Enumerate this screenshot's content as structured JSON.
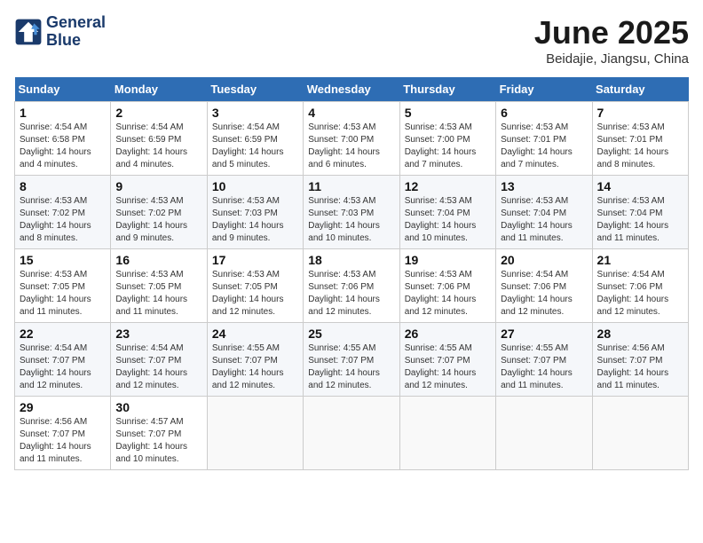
{
  "header": {
    "logo": {
      "line1": "General",
      "line2": "Blue"
    },
    "title": "June 2025",
    "location": "Beidajie, Jiangsu, China"
  },
  "weekdays": [
    "Sunday",
    "Monday",
    "Tuesday",
    "Wednesday",
    "Thursday",
    "Friday",
    "Saturday"
  ],
  "weeks": [
    [
      {
        "day": 1,
        "sunrise": "4:54 AM",
        "sunset": "6:58 PM",
        "daylight": "14 hours and 4 minutes."
      },
      {
        "day": 2,
        "sunrise": "4:54 AM",
        "sunset": "6:59 PM",
        "daylight": "14 hours and 4 minutes."
      },
      {
        "day": 3,
        "sunrise": "4:54 AM",
        "sunset": "6:59 PM",
        "daylight": "14 hours and 5 minutes."
      },
      {
        "day": 4,
        "sunrise": "4:53 AM",
        "sunset": "7:00 PM",
        "daylight": "14 hours and 6 minutes."
      },
      {
        "day": 5,
        "sunrise": "4:53 AM",
        "sunset": "7:00 PM",
        "daylight": "14 hours and 7 minutes."
      },
      {
        "day": 6,
        "sunrise": "4:53 AM",
        "sunset": "7:01 PM",
        "daylight": "14 hours and 7 minutes."
      },
      {
        "day": 7,
        "sunrise": "4:53 AM",
        "sunset": "7:01 PM",
        "daylight": "14 hours and 8 minutes."
      }
    ],
    [
      {
        "day": 8,
        "sunrise": "4:53 AM",
        "sunset": "7:02 PM",
        "daylight": "14 hours and 8 minutes."
      },
      {
        "day": 9,
        "sunrise": "4:53 AM",
        "sunset": "7:02 PM",
        "daylight": "14 hours and 9 minutes."
      },
      {
        "day": 10,
        "sunrise": "4:53 AM",
        "sunset": "7:03 PM",
        "daylight": "14 hours and 9 minutes."
      },
      {
        "day": 11,
        "sunrise": "4:53 AM",
        "sunset": "7:03 PM",
        "daylight": "14 hours and 10 minutes."
      },
      {
        "day": 12,
        "sunrise": "4:53 AM",
        "sunset": "7:04 PM",
        "daylight": "14 hours and 10 minutes."
      },
      {
        "day": 13,
        "sunrise": "4:53 AM",
        "sunset": "7:04 PM",
        "daylight": "14 hours and 11 minutes."
      },
      {
        "day": 14,
        "sunrise": "4:53 AM",
        "sunset": "7:04 PM",
        "daylight": "14 hours and 11 minutes."
      }
    ],
    [
      {
        "day": 15,
        "sunrise": "4:53 AM",
        "sunset": "7:05 PM",
        "daylight": "14 hours and 11 minutes."
      },
      {
        "day": 16,
        "sunrise": "4:53 AM",
        "sunset": "7:05 PM",
        "daylight": "14 hours and 11 minutes."
      },
      {
        "day": 17,
        "sunrise": "4:53 AM",
        "sunset": "7:05 PM",
        "daylight": "14 hours and 12 minutes."
      },
      {
        "day": 18,
        "sunrise": "4:53 AM",
        "sunset": "7:06 PM",
        "daylight": "14 hours and 12 minutes."
      },
      {
        "day": 19,
        "sunrise": "4:53 AM",
        "sunset": "7:06 PM",
        "daylight": "14 hours and 12 minutes."
      },
      {
        "day": 20,
        "sunrise": "4:54 AM",
        "sunset": "7:06 PM",
        "daylight": "14 hours and 12 minutes."
      },
      {
        "day": 21,
        "sunrise": "4:54 AM",
        "sunset": "7:06 PM",
        "daylight": "14 hours and 12 minutes."
      }
    ],
    [
      {
        "day": 22,
        "sunrise": "4:54 AM",
        "sunset": "7:07 PM",
        "daylight": "14 hours and 12 minutes."
      },
      {
        "day": 23,
        "sunrise": "4:54 AM",
        "sunset": "7:07 PM",
        "daylight": "14 hours and 12 minutes."
      },
      {
        "day": 24,
        "sunrise": "4:55 AM",
        "sunset": "7:07 PM",
        "daylight": "14 hours and 12 minutes."
      },
      {
        "day": 25,
        "sunrise": "4:55 AM",
        "sunset": "7:07 PM",
        "daylight": "14 hours and 12 minutes."
      },
      {
        "day": 26,
        "sunrise": "4:55 AM",
        "sunset": "7:07 PM",
        "daylight": "14 hours and 12 minutes."
      },
      {
        "day": 27,
        "sunrise": "4:55 AM",
        "sunset": "7:07 PM",
        "daylight": "14 hours and 11 minutes."
      },
      {
        "day": 28,
        "sunrise": "4:56 AM",
        "sunset": "7:07 PM",
        "daylight": "14 hours and 11 minutes."
      }
    ],
    [
      {
        "day": 29,
        "sunrise": "4:56 AM",
        "sunset": "7:07 PM",
        "daylight": "14 hours and 11 minutes."
      },
      {
        "day": 30,
        "sunrise": "4:57 AM",
        "sunset": "7:07 PM",
        "daylight": "14 hours and 10 minutes."
      },
      null,
      null,
      null,
      null,
      null
    ]
  ],
  "labels": {
    "sunrise": "Sunrise:",
    "sunset": "Sunset:",
    "daylight": "Daylight:"
  }
}
